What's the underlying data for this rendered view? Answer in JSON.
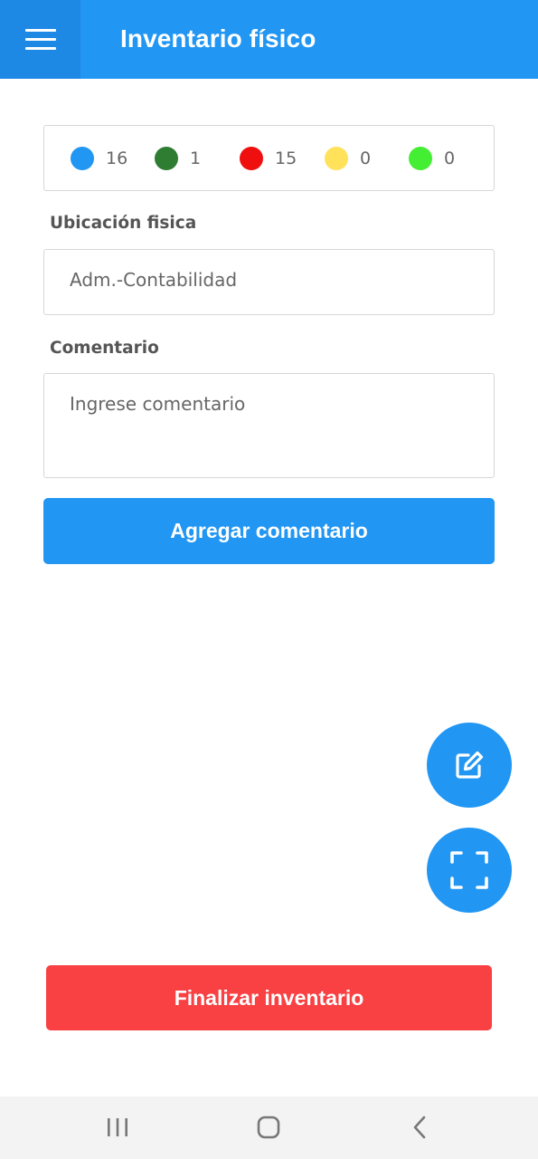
{
  "header": {
    "title": "Inventario físico",
    "menu_icon": "hamburger-menu-icon",
    "bg_color": "#2196f3"
  },
  "status_counts": [
    {
      "color": "#2196f3",
      "value": "16"
    },
    {
      "color": "#2e7d32",
      "value": "1"
    },
    {
      "color": "#f00f0f",
      "value": "15"
    },
    {
      "color": "#ffe15a",
      "value": "0"
    },
    {
      "color": "#44ee33",
      "value": "0"
    }
  ],
  "location": {
    "label": "Ubicación fisica",
    "value": "Adm.-Contabilidad"
  },
  "comment": {
    "label": "Comentario",
    "placeholder": "Ingrese comentario"
  },
  "buttons": {
    "add_comment": "Agregar comentario",
    "finish_inventory": "Finalizar inventario"
  },
  "fabs": [
    {
      "icon": "edit-icon"
    },
    {
      "icon": "scan-frame-icon"
    }
  ],
  "system_nav": [
    {
      "icon": "recent-apps-icon"
    },
    {
      "icon": "home-icon"
    },
    {
      "icon": "back-icon"
    }
  ]
}
